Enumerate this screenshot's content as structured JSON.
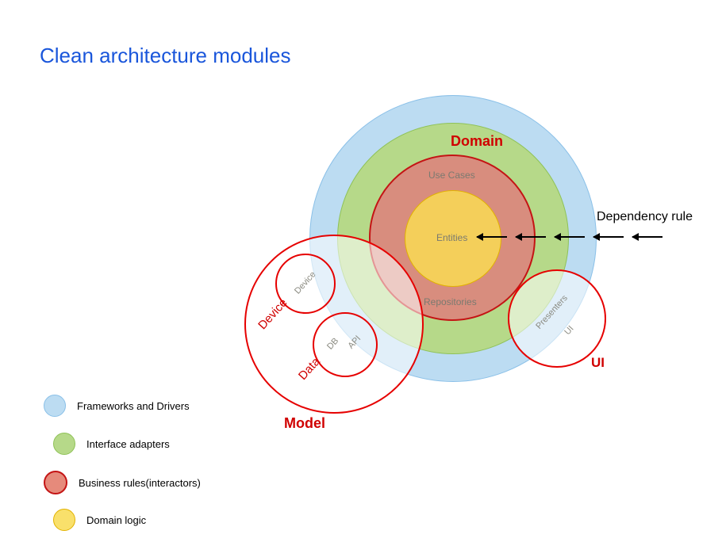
{
  "title": "Clean architecture modules",
  "dependency_rule_label": "Dependency rule",
  "rings": {
    "outer": {
      "label": "",
      "fill": "#bcdcf2",
      "stroke": "#8ac0e8"
    },
    "green": {
      "label": "",
      "fill": "#b6d989",
      "stroke": "#8fc257"
    },
    "red": {
      "label_top": "Use Cases",
      "label_bottom": "Repositories",
      "fill": "#d88d7e",
      "stroke": "#c41414"
    },
    "yellow": {
      "label": "Entities",
      "fill": "#f4cf5a",
      "stroke": "#e2b200"
    }
  },
  "domain_label": "Domain",
  "overlays": {
    "model": {
      "label": "Model",
      "sub_device": "Device",
      "sub_data": "Data",
      "inner": {
        "device": "Device",
        "db": "DB",
        "api": "API"
      }
    },
    "ui": {
      "label": "UI",
      "inner": {
        "presenters": "Presenters",
        "ui": "UI"
      }
    }
  },
  "legend": [
    {
      "text": "Frameworks and Drivers",
      "fill": "#bcdcf2",
      "stroke": "#8ac0e8"
    },
    {
      "text": "Interface adapters",
      "fill": "#b6d989",
      "stroke": "#8fc257"
    },
    {
      "text": "Business rules(interactors)",
      "fill": "#e68a7b",
      "stroke": "#c41414"
    },
    {
      "text": "Domain logic",
      "fill": "#f9e06b",
      "stroke": "#e2b200"
    }
  ],
  "colors": {
    "label_red": "#d00000"
  }
}
